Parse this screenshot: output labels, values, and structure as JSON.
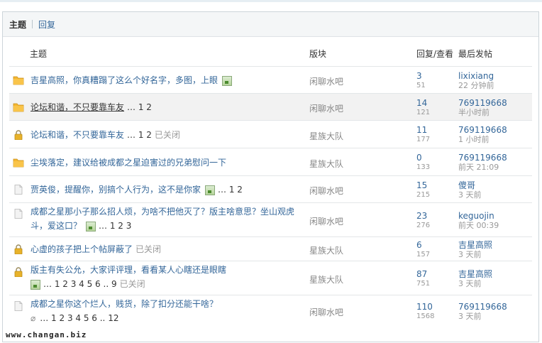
{
  "tabs": [
    {
      "label": "主题",
      "active": true
    },
    {
      "label": "回复",
      "active": false
    }
  ],
  "headers": {
    "subject": "主题",
    "forum": "版块",
    "stats": "回复/查看",
    "last": "最后发帖"
  },
  "threads": [
    {
      "subject": "吉星高照，你真糟蹋了这么个好名字，多图，上眼",
      "has_image": true,
      "pages": "",
      "closed": "",
      "forum": "闲聊水吧",
      "replies": "3",
      "views": "51",
      "last_user": "lixixiang",
      "last_time": "22 分钟前"
    },
    {
      "subject": "论坛和谐，不只要靠车友",
      "has_image": false,
      "pages": "… 1 2",
      "closed": "",
      "forum": "闲聊水吧",
      "replies": "14",
      "views": "121",
      "last_user": "769119668",
      "last_time": "半小时前"
    },
    {
      "subject": "论坛和谐，不只要靠车友",
      "has_image": false,
      "pages": "… 1 2",
      "closed": "已关闭",
      "forum": "星族大队",
      "replies": "11",
      "views": "177",
      "last_user": "769119668",
      "last_time": "1 小时前"
    },
    {
      "subject": "尘埃落定，建议给被成都之星迫害过的兄弟慰问一下",
      "has_image": false,
      "pages": "",
      "closed": "",
      "forum": "星族大队",
      "replies": "0",
      "views": "133",
      "last_user": "769119668",
      "last_time": "前天 21:09"
    },
    {
      "subject": "贾英俊，提醒你，别搞个人行为，这不是你家",
      "has_image": true,
      "pages": "… 1 2",
      "closed": "",
      "forum": "闲聊水吧",
      "replies": "15",
      "views": "215",
      "last_user": "傻哥",
      "last_time": "3 天前"
    },
    {
      "subject": "成都之星那小子那么招人烦，为啥不把他灭了？版主啥意思？坐山观虎",
      "subject2": "斗，爱这口？",
      "has_image": true,
      "pages": "… 1 2 3",
      "closed": "",
      "forum": "闲聊水吧",
      "replies": "23",
      "views": "276",
      "last_user": "keguojin",
      "last_time": "前天 00:39"
    },
    {
      "subject": "心虚的孩子把上个帖屏蔽了",
      "has_image": false,
      "pages": "",
      "closed": "已关闭",
      "forum": "星族大队",
      "replies": "6",
      "views": "157",
      "last_user": "吉星高照",
      "last_time": "3 天前"
    },
    {
      "subject": "版主有失公允，大家评评理，看看某人心瞎还是眼瞎",
      "subject2": "",
      "has_image": true,
      "pages": "… 1 2 3 4 5 6 .. 9",
      "closed": "已关闭",
      "forum": "星族大队",
      "replies": "87",
      "views": "751",
      "last_user": "吉星高照",
      "last_time": "3 天前"
    },
    {
      "subject": "成都之星你这个烂人，贱货，除了扣分还能干啥？",
      "subject2": "",
      "has_image": false,
      "has_clip": true,
      "pages": "… 1 2 3 4 5 6 .. 12",
      "closed": "",
      "forum": "闲聊水吧",
      "replies": "110",
      "views": "1568",
      "last_user": "769119668",
      "last_time": "3 天前"
    }
  ],
  "watermark": "www.changan.biz",
  "icon_colors": {
    "folder": "#f5b731",
    "lock": "#e8b22a",
    "doc": "#d9d9d9"
  }
}
